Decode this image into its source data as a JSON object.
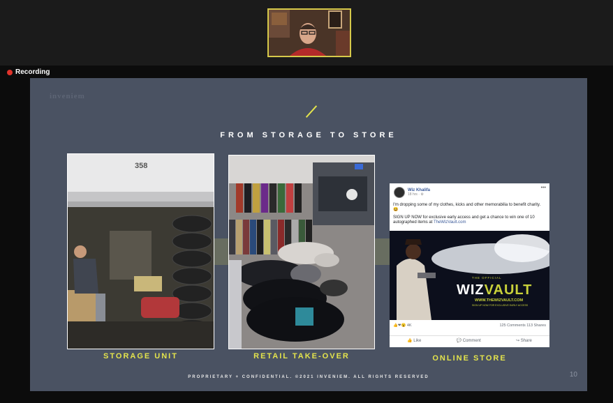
{
  "recording": {
    "label": "Recording"
  },
  "slide": {
    "logo": "inveniem",
    "title": "FROM STORAGE TO STORE",
    "captions": [
      "STORAGE UNIT",
      "RETAIL TAKE-OVER",
      "ONLINE STORE"
    ],
    "unit_number": "358",
    "footer": "PROPRIETARY + CONFIDENTIAL. ©2021 INVENIEM. ALL RIGHTS RESERVED",
    "page_number": "10"
  },
  "post": {
    "author": "Wiz Khalifa",
    "time": "18 hrs · ⚙",
    "menu": "•••",
    "text1": "I'm dropping some of my clothes, kicks and other memorabilia to benefit charity. 😆",
    "text2": "SIGN UP NOW for exclusive early access and get a chance to win one of 10 autographed items at",
    "link": "TheWizVault.com",
    "image": {
      "official": "THE OFFICIAL",
      "brand_a": "WIZ",
      "brand_b": "VAULT",
      "url": "WWW.THEWIZVAULT.COM",
      "sub": "SIGN UP NOW FOR EXCLUSIVE EARLY ACCESS"
    },
    "reactions": "4K",
    "comments": "125 Comments",
    "shares": "113 Shares",
    "like": "Like",
    "comment": "Comment",
    "share": "Share"
  }
}
